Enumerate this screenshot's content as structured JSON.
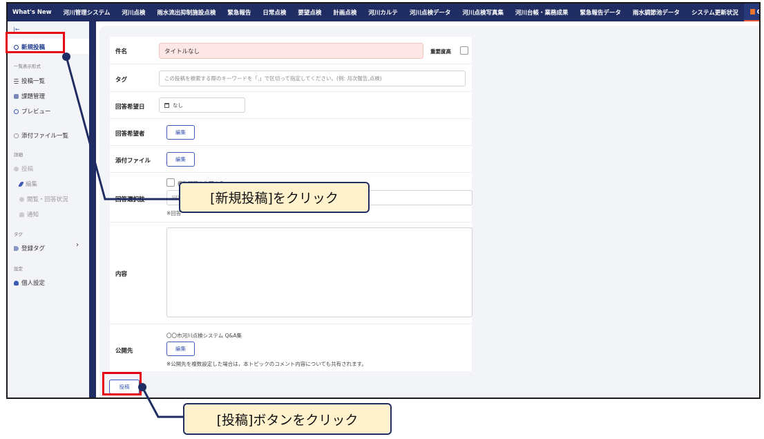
{
  "topnav": {
    "items": [
      "What's New",
      "河川管理システム",
      "河川点検",
      "雨水流出抑制施設点検",
      "緊急報告",
      "日常点検",
      "要望点検",
      "計画点検",
      "河川カルテ",
      "河川点検データ",
      "河川点検写真集",
      "河川台帳・業務成果",
      "緊急報告データ",
      "雨水調節池データ",
      "システム更新状況"
    ],
    "qa_label": "Q&A集"
  },
  "sidebar": {
    "collapse_glyph": "|←",
    "new_post": "新規投稿",
    "heading_list": "一覧表示形式",
    "post_list": "投稿一覧",
    "task_mgmt": "課題管理",
    "preview": "プレビュー",
    "attachments_list": "添付ファイル一覧",
    "heading_detail": "詳細",
    "post": "投稿",
    "edit": "編集",
    "view_status": "閲覧・回答状況",
    "notify": "通知",
    "heading_tag": "タグ",
    "registered_tags": "登録タグ",
    "heading_settings": "設定",
    "personal_settings": "個人設定"
  },
  "form": {
    "title_label": "件名",
    "title_value": "タイトルなし",
    "importance_label": "重要度高",
    "tag_label": "タグ",
    "tag_placeholder": "この投稿を検索する際のキーワードを「,」で区切って指定してください。(例: 月次報告,点検)",
    "due_label": "回答希望日",
    "due_value": "なし",
    "respondent_label": "回答希望者",
    "edit_label": "編集",
    "attach_label": "添付ファイル",
    "choices_label": "回答選択肢",
    "allow_multiple": "複数回答を許可する",
    "choices_placeholder": "回答",
    "choices_note": "※回答",
    "content_label": "内容",
    "publish_label": "公開先",
    "publish_target": "〇〇市河川点検システム Q&A集",
    "publish_note": "※公開先を複数設定した場合は，本トピックのコメント内容についても共有されます。",
    "submit": "投稿"
  },
  "callouts": {
    "new_post": "[新規投稿]をクリック",
    "submit": "[投稿]ボタンをクリック"
  },
  "colors": {
    "nav": "#1f2d63",
    "accent": "#3d5ab5",
    "highlight": "#e60012",
    "callout_bg": "#fff2cc"
  }
}
